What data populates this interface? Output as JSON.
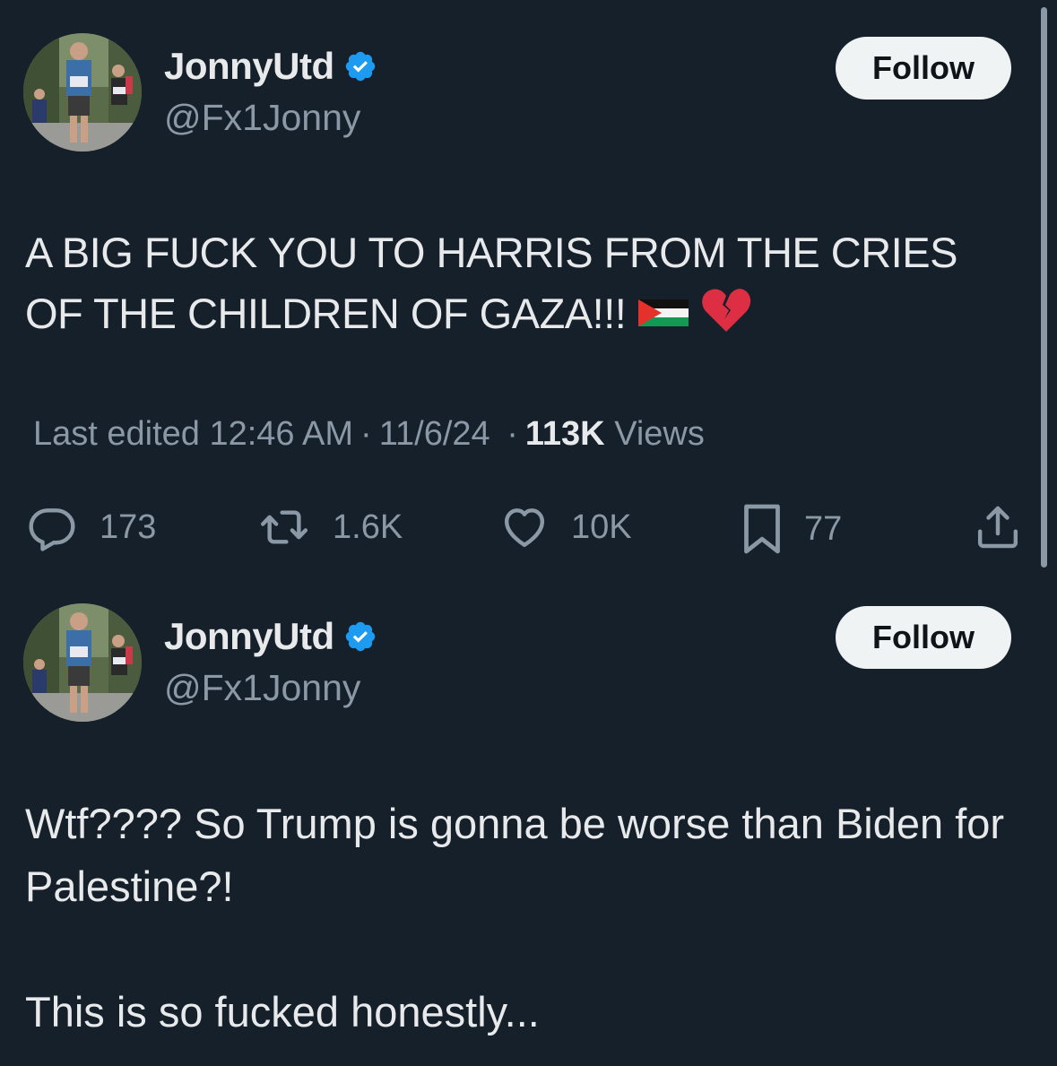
{
  "tweets": [
    {
      "display_name": "JonnyUtd",
      "handle": "@Fx1Jonny",
      "follow_label": "Follow",
      "text": "A BIG FUCK YOU TO HARRIS FROM THE CRIES OF THE CHILDREN OF GAZA!!!",
      "emojis": [
        "palestine-flag",
        "broken-heart"
      ],
      "meta": {
        "edited_label": "Last edited 12:46 AM",
        "date": "11/6/24",
        "views_count": "113K",
        "views_label": "Views"
      },
      "actions": {
        "replies": "173",
        "reposts": "1.6K",
        "likes": "10K",
        "bookmarks": "77"
      }
    },
    {
      "display_name": "JonnyUtd",
      "handle": "@Fx1Jonny",
      "follow_label": "Follow",
      "text": "Wtf???? So Trump is gonna be worse than Biden for Palestine?!\n\nThis is so fucked honestly..."
    }
  ],
  "theme": {
    "background": "#15202b",
    "text": "#e7e9ea",
    "secondary_text": "#8b98a5",
    "verified_blue": "#1d9bf0",
    "follow_button_bg": "#eff3f4"
  }
}
